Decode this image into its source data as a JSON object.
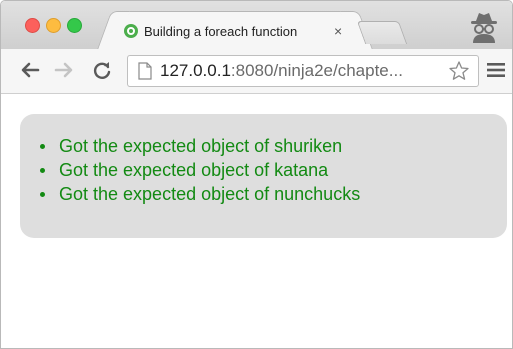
{
  "window": {
    "tab": {
      "title": "Building a foreach function",
      "close_glyph": "×"
    },
    "omnibox": {
      "url_host": "127.0.0.1",
      "url_rest": ":8080/ninja2e/chapte..."
    }
  },
  "page": {
    "results": [
      "Got the expected object of shuriken",
      "Got the expected object of katana",
      "Got the expected object of nunchucks"
    ]
  },
  "colors": {
    "pass_text": "#138a13",
    "result_box_bg": "#dedede"
  },
  "icons": [
    "close-icon",
    "incognito-icon",
    "back-icon",
    "forward-icon",
    "reload-icon",
    "page-icon",
    "star-icon",
    "menu-icon"
  ]
}
